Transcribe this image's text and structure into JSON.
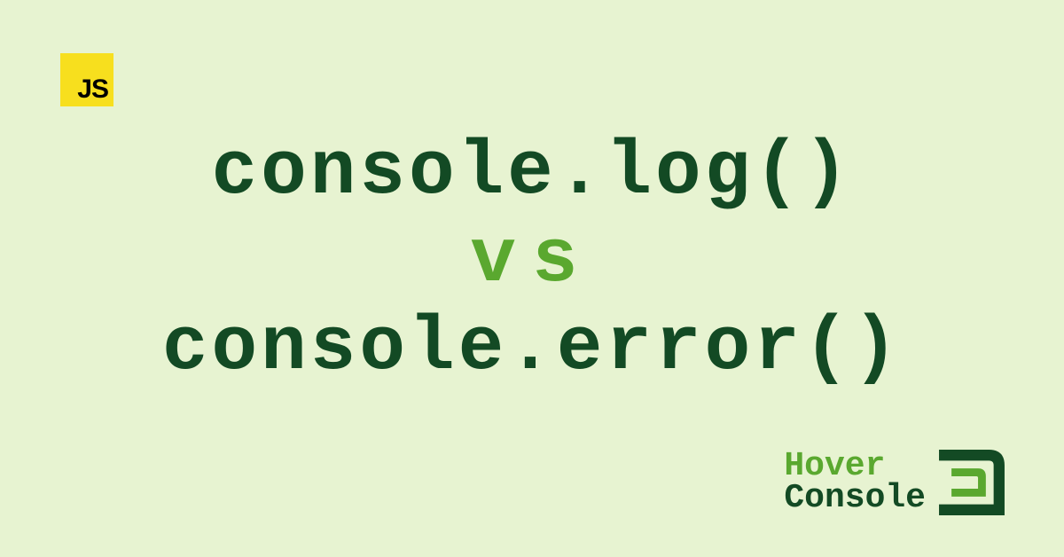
{
  "badges": {
    "js": "JS"
  },
  "title": {
    "line1": "console.log()",
    "line2": "vs",
    "line3": "console.error()"
  },
  "brand": {
    "word1": "Hover",
    "word2": "Console"
  },
  "colors": {
    "background": "#e7f3d1",
    "js_yellow": "#f7df1e",
    "dark_green": "#134a24",
    "light_green": "#5aa82f"
  }
}
